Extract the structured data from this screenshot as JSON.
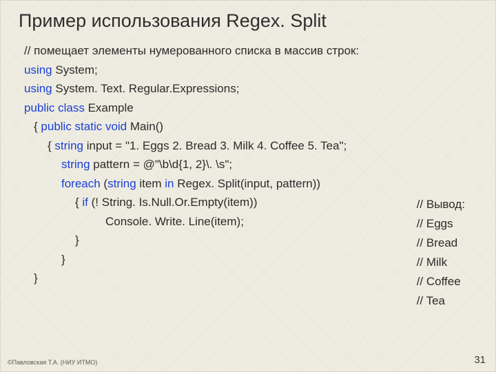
{
  "title": "Пример использования Regex. Split",
  "code": {
    "l1": "// помещает элементы нумерованного списка в массив строк:",
    "l2a": "using",
    "l2b": " System;",
    "l3a": "using",
    "l3b": " System. Text. Regular.Expressions;",
    "l4a": "public class",
    "l4b": " Example",
    "l5a": "{  ",
    "l5b": "public static void",
    "l5c": " Main()",
    "l6a": "{ ",
    "l6b": "string",
    "l6c": " input = \"1. Eggs 2. Bread 3. Milk 4. Coffee 5. Tea\";",
    "l7a": "string",
    "l7b": " pattern = @\"\\b\\d{1, 2}\\. \\s\";",
    "l8a": "foreach",
    "l8b": " (",
    "l8c": "string",
    "l8d": " item ",
    "l8e": "in",
    "l8f": " Regex. Split(input, pattern))",
    "l9a": "{ ",
    "l9b": "if",
    "l9c": " (! String. Is.Null.Or.Empty(item))",
    "l10": "Console. Write. Line(item);",
    "l11": "}",
    "l12": "}",
    "l13": "}"
  },
  "output": {
    "o1": "// Вывод:",
    "o2": "// Eggs",
    "o3": "// Bread",
    "o4": "// Milk",
    "o5": "// Coffee",
    "o6": "// Tea"
  },
  "footer": {
    "left": "©Павловская Т.А. (НИУ ИТМО)",
    "right": "31"
  }
}
